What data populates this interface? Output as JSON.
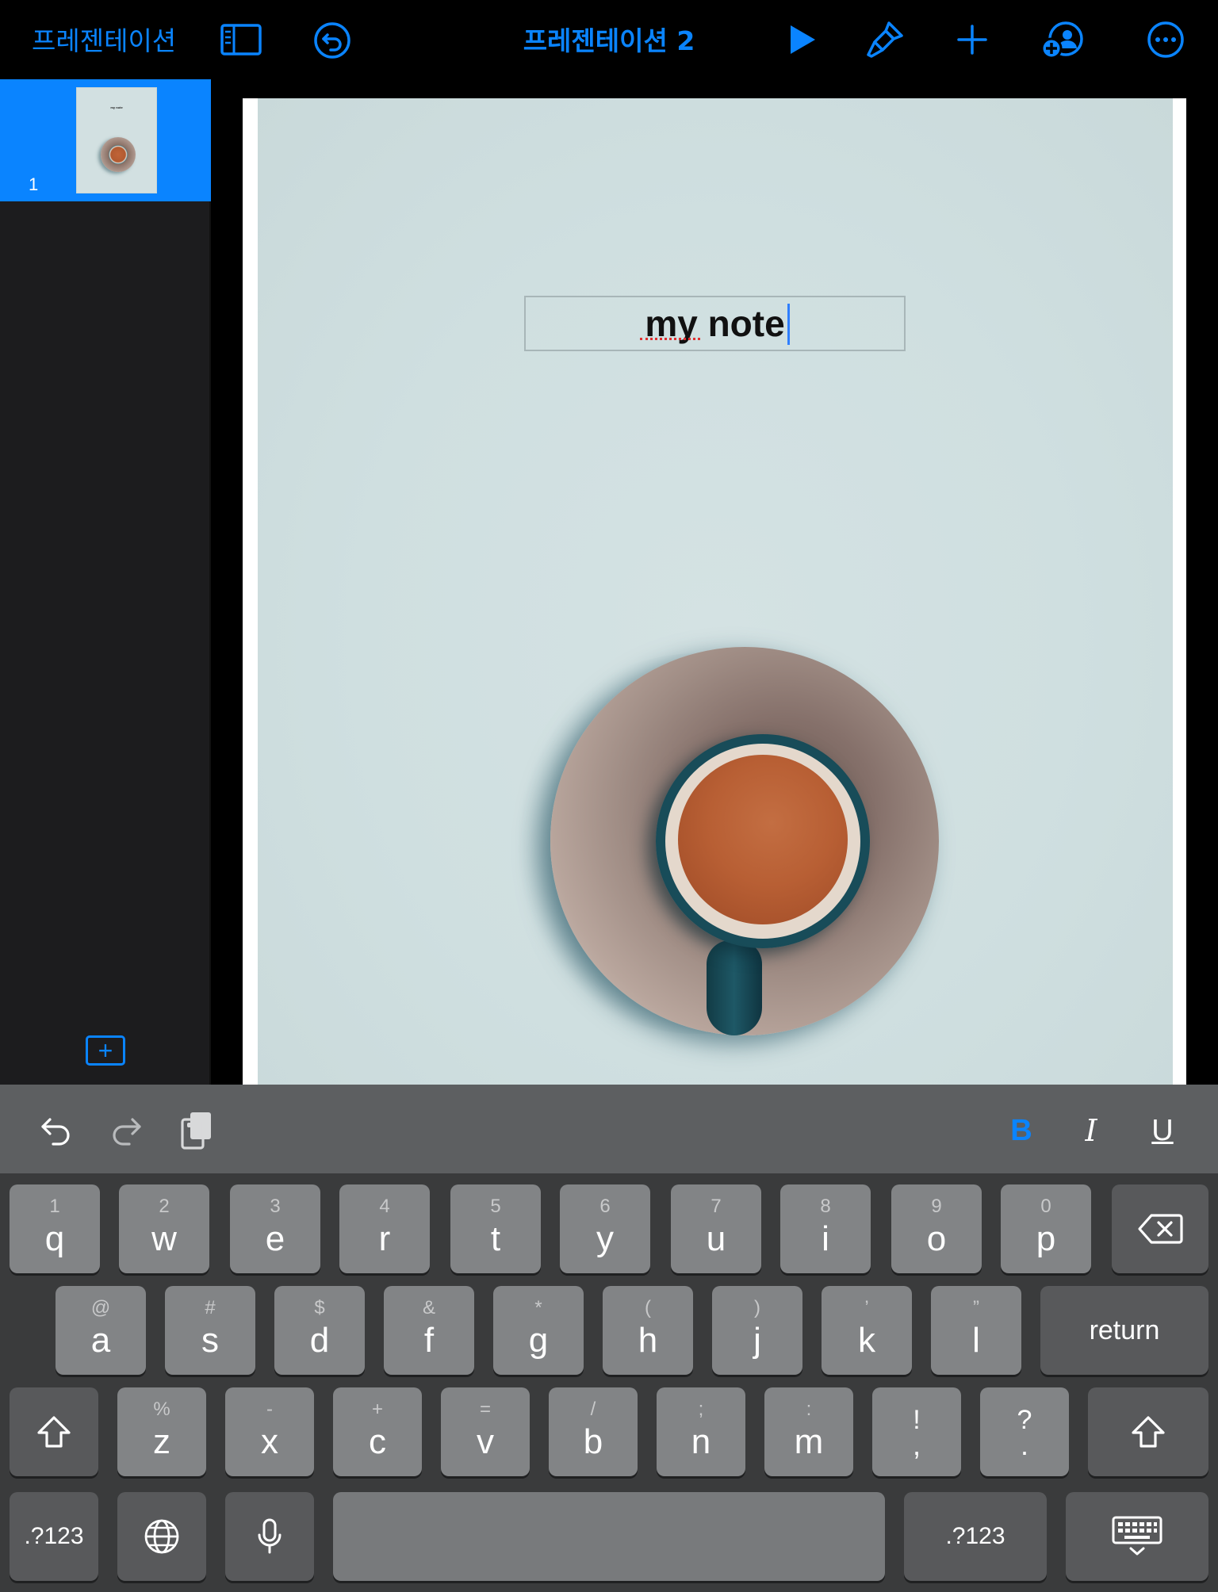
{
  "topbar": {
    "back_label": "프레젠테이션",
    "title": "프레젠테이션 2",
    "accent_color": "#0a84ff",
    "icons": [
      "sidebar-toggle-icon",
      "undo-circle-icon",
      "play-icon",
      "format-brush-icon",
      "plus-icon",
      "collaborate-icon",
      "more-icon"
    ]
  },
  "sidebar": {
    "slides": [
      {
        "number": "1",
        "thumb_text": "my note"
      }
    ],
    "selected_slide": 1,
    "add_slide_icon": "plus-square-icon"
  },
  "slide": {
    "text_box": "my note",
    "image": "coffee-cup-on-saucer"
  },
  "keyboard": {
    "shortcut_bar": {
      "undo_icon": "undo-arrow-icon",
      "redo_icon": "redo-arrow-icon",
      "paste_icon": "clipboard-icon",
      "bold": "B",
      "italic": "I",
      "underline": "U",
      "bold_active": true
    },
    "row1": [
      {
        "hint": "1",
        "key": "q"
      },
      {
        "hint": "2",
        "key": "w"
      },
      {
        "hint": "3",
        "key": "e"
      },
      {
        "hint": "4",
        "key": "r"
      },
      {
        "hint": "5",
        "key": "t"
      },
      {
        "hint": "6",
        "key": "y"
      },
      {
        "hint": "7",
        "key": "u"
      },
      {
        "hint": "8",
        "key": "i"
      },
      {
        "hint": "9",
        "key": "o"
      },
      {
        "hint": "0",
        "key": "p"
      }
    ],
    "row2": [
      {
        "hint": "@",
        "key": "a"
      },
      {
        "hint": "#",
        "key": "s"
      },
      {
        "hint": "$",
        "key": "d"
      },
      {
        "hint": "&",
        "key": "f"
      },
      {
        "hint": "*",
        "key": "g"
      },
      {
        "hint": "(",
        "key": "h"
      },
      {
        "hint": ")",
        "key": "j"
      },
      {
        "hint": "’",
        "key": "k"
      },
      {
        "hint": "”",
        "key": "l"
      }
    ],
    "row3": [
      {
        "hint": "%",
        "key": "z"
      },
      {
        "hint": "-",
        "key": "x"
      },
      {
        "hint": "+",
        "key": "c"
      },
      {
        "hint": "=",
        "key": "v"
      },
      {
        "hint": "/",
        "key": "b"
      },
      {
        "hint": ";",
        "key": "n"
      },
      {
        "hint": ":",
        "key": "m"
      },
      {
        "hint": "!",
        "key": ","
      },
      {
        "hint": "?",
        "key": "."
      }
    ],
    "return_label": "return",
    "numbers_label": ".?123",
    "globe_icon": "globe-icon",
    "mic_icon": "microphone-icon",
    "hide_icon": "keyboard-hide-icon",
    "shift_icon": "shift-icon",
    "delete_icon": "delete-icon"
  }
}
